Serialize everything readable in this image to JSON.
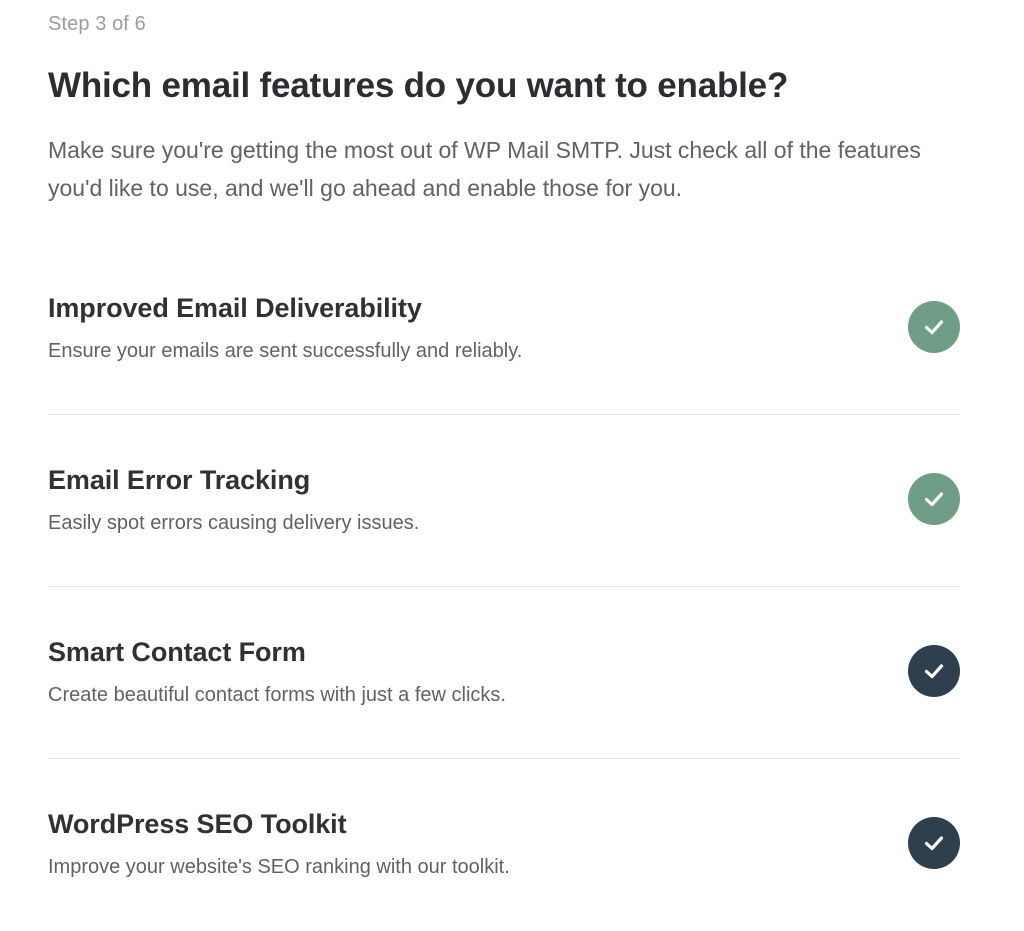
{
  "wizard": {
    "step_label": "Step 3 of 6",
    "title": "Which email features do you want to enable?",
    "intro": "Make sure you're getting the most out of WP Mail SMTP. Just check all of the features you'd like to use, and we'll go ahead and enable those for you."
  },
  "features": [
    {
      "title": "Improved Email Deliverability",
      "description": "Ensure your emails are sent successfully and reliably.",
      "checked": true,
      "check_color": "#6f9d85",
      "icon": "check-icon"
    },
    {
      "title": "Email Error Tracking",
      "description": "Easily spot errors causing delivery issues.",
      "checked": true,
      "check_color": "#6f9d85",
      "icon": "check-icon"
    },
    {
      "title": "Smart Contact Form",
      "description": "Create beautiful contact forms with just a few clicks.",
      "checked": true,
      "check_color": "#2f3f4e",
      "icon": "check-icon"
    },
    {
      "title": "WordPress SEO Toolkit",
      "description": "Improve your website's SEO ranking with our toolkit.",
      "checked": true,
      "check_color": "#2f3f4e",
      "icon": "check-icon"
    }
  ]
}
